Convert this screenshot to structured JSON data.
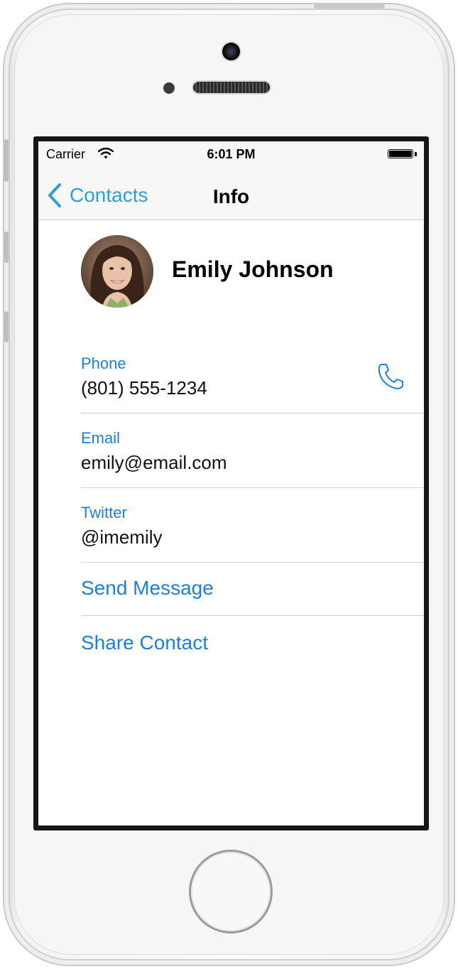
{
  "status_bar": {
    "carrier": "Carrier",
    "time": "6:01 PM"
  },
  "nav": {
    "back_label": "Contacts",
    "title": "Info"
  },
  "contact": {
    "name": "Emily Johnson",
    "fields": [
      {
        "label": "Phone",
        "value": "(801) 555-1234"
      },
      {
        "label": "Email",
        "value": "emily@email.com"
      },
      {
        "label": "Twitter",
        "value": "@imemily"
      }
    ],
    "actions": [
      {
        "label": "Send Message"
      },
      {
        "label": "Share Contact"
      }
    ]
  },
  "icons": {
    "back": "chevron-left-icon",
    "wifi": "wifi-icon",
    "battery": "battery-icon",
    "call": "phone-icon",
    "home": "home-button"
  },
  "colors": {
    "accent": "#1a7fde",
    "nav_accent": "#2aa0d5",
    "separator": "#d0d0d5"
  }
}
